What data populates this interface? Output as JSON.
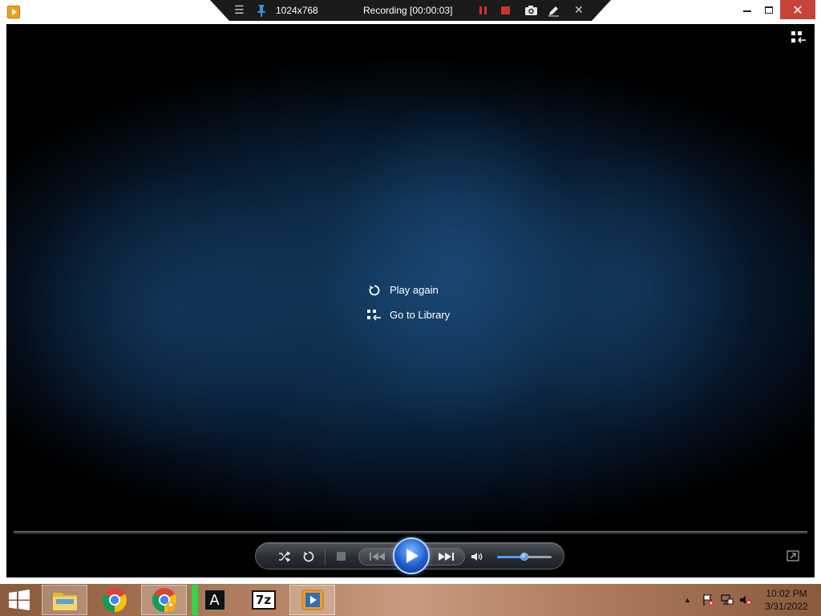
{
  "window": {
    "minimize_symbol": "",
    "close_symbol": "✕",
    "icon": "media-player-icon"
  },
  "recorder": {
    "menu_symbol": "☰",
    "resolution": "1024x768",
    "status": "Recording [00:00:03]",
    "close_symbol": "✕",
    "pause_color": "#d0312d",
    "stop_color": "#d0312d"
  },
  "player": {
    "end_menu": {
      "play_again": "Play again",
      "go_to_library": "Go to Library"
    },
    "volume_level": 0.5,
    "accent_color": "#3b8ef5"
  },
  "taskbar": {
    "apps": [
      "file-explorer",
      "chrome",
      "chrome-profile",
      "font-viewer",
      "7-zip",
      "media-player"
    ],
    "font_app_label": "A",
    "zip_app_label": "7z",
    "tray_overflow_symbol": "▲",
    "time": "10:02 PM",
    "date": "3/31/2022"
  }
}
